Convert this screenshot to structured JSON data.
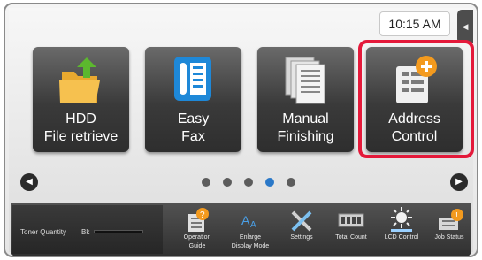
{
  "status_bar": {
    "time": "10:15 AM",
    "side_tab_icon": "collapse-arrow-icon"
  },
  "tiles": [
    {
      "name": "hdd-file-retrieve",
      "line1": "HDD",
      "line2": "File retrieve",
      "icon": "folder-upload-icon"
    },
    {
      "name": "easy-fax",
      "line1": "Easy",
      "line2": "Fax",
      "icon": "fax-phone-icon"
    },
    {
      "name": "manual-finishing",
      "line1": "Manual",
      "line2": "Finishing",
      "icon": "document-stack-icon"
    },
    {
      "name": "address-control",
      "line1": "Address",
      "line2": "Control",
      "icon": "address-book-add-icon",
      "highlighted": true
    }
  ],
  "pager": {
    "page_count": 5,
    "active_page": 4
  },
  "toner": {
    "label": "Toner Quantity",
    "color_label": "Bk"
  },
  "quick_buttons": [
    {
      "name": "operation-guide",
      "line1": "Operation",
      "line2": "Guide",
      "icon": "help-book-icon"
    },
    {
      "name": "enlarge-display-mode",
      "line1": "Enlarge",
      "line2": "Display Mode",
      "icon": "enlarge-text-icon"
    },
    {
      "name": "settings",
      "line1": "Settings",
      "line2": "",
      "icon": "tools-icon"
    },
    {
      "name": "total-count",
      "line1": "Total Count",
      "line2": "",
      "icon": "counter-icon"
    },
    {
      "name": "lcd-control",
      "line1": "LCD Control",
      "line2": "",
      "icon": "brightness-icon"
    },
    {
      "name": "job-status",
      "line1": "Job Status",
      "line2": "",
      "icon": "job-status-icon"
    }
  ],
  "colors": {
    "highlight": "#e4193a",
    "active_dot": "#2a78c8",
    "accent_orange": "#f39a1e",
    "fax_blue": "#1e88d8",
    "folder_green": "#5cb82e"
  }
}
